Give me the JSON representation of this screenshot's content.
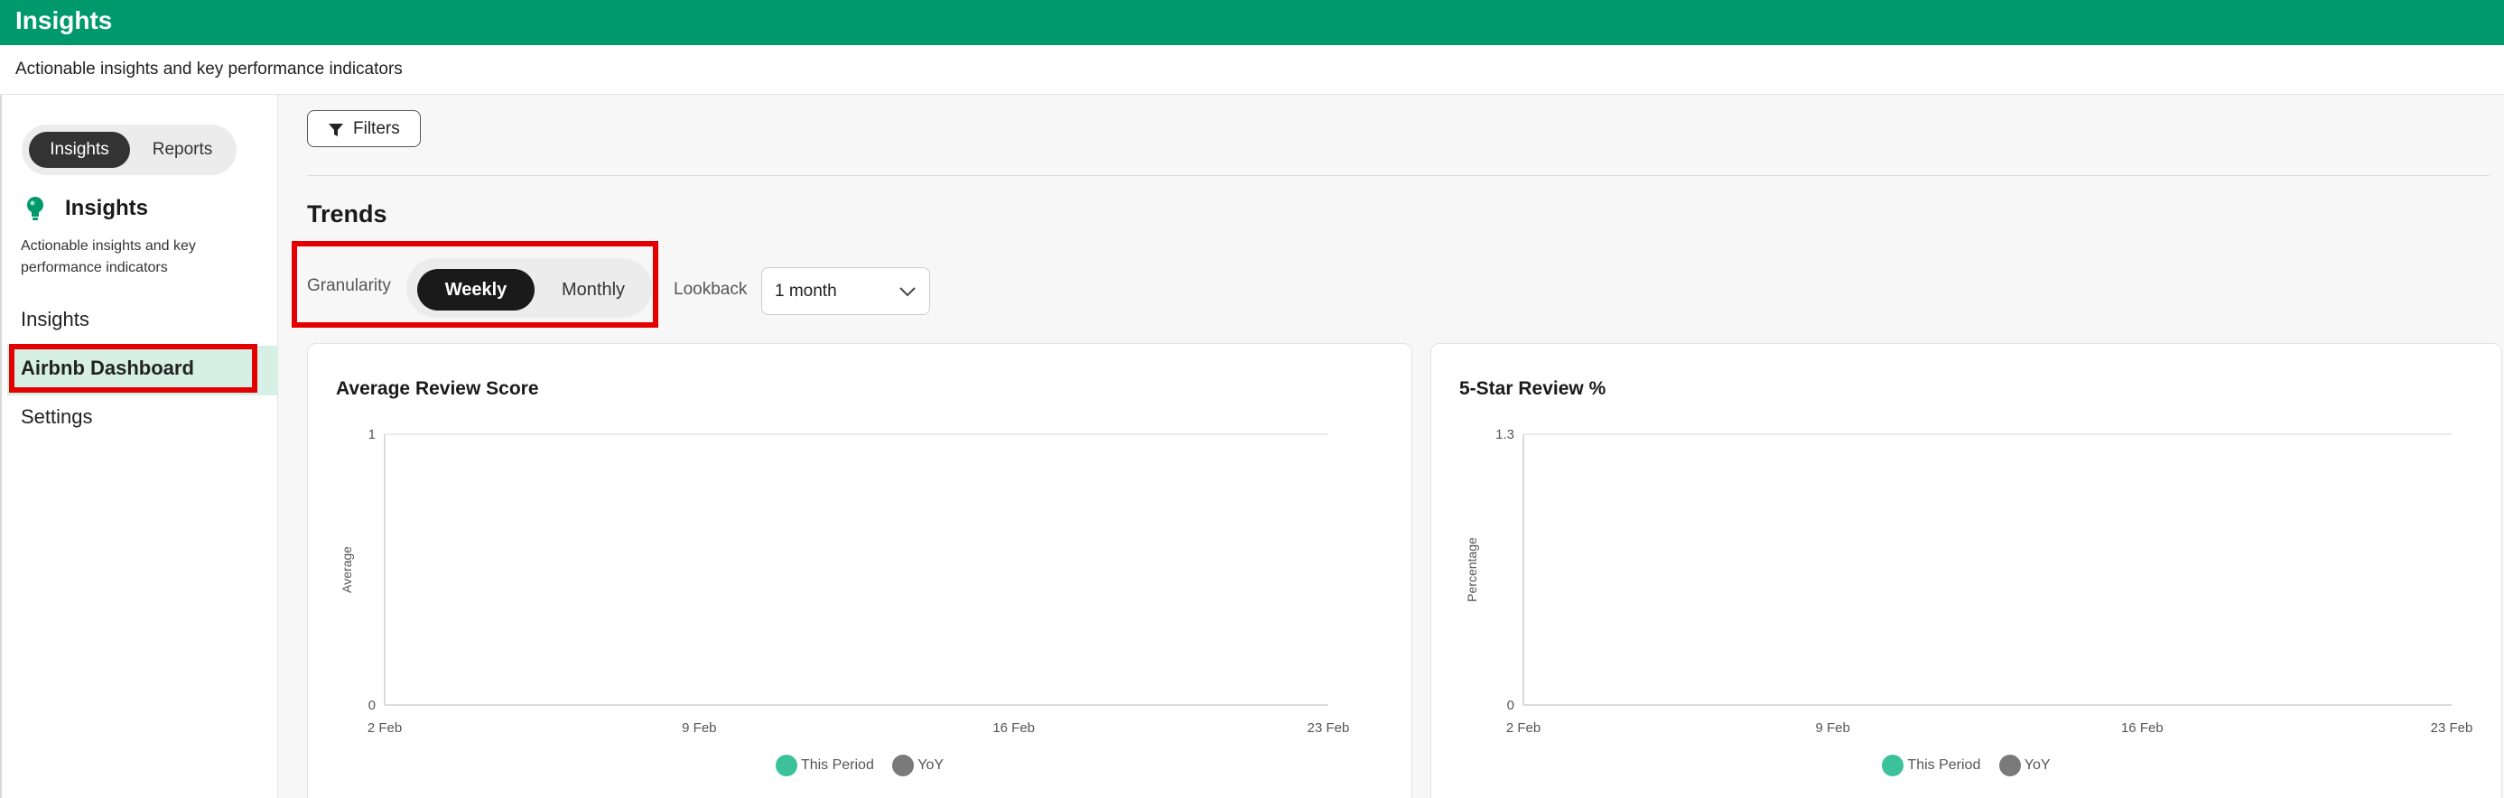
{
  "app": {
    "title": "Insights",
    "subtitle": "Actionable insights and key performance indicators"
  },
  "sidebar": {
    "segment": {
      "options": [
        "Insights",
        "Reports"
      ],
      "selected": "Insights"
    },
    "title": "Insights",
    "icon": "lightbulb-icon",
    "description": "Actionable insights and key performance indicators",
    "items": [
      {
        "label": "Insights"
      },
      {
        "label": "Airbnb Dashboard",
        "active": true
      },
      {
        "label": "Settings"
      }
    ]
  },
  "toolbar": {
    "filters_label": "Filters",
    "filters_icon": "filter-icon"
  },
  "trends": {
    "title": "Trends",
    "granularity_label": "Granularity",
    "granularity_options": [
      "Weekly",
      "Monthly"
    ],
    "granularity_selected": "Weekly",
    "lookback_label": "Lookback",
    "lookback_value": "1 month"
  },
  "colors": {
    "brand": "#00996b",
    "this_period": "#3cc29a",
    "yoy": "#7a7a7a",
    "highlight": "#e30000"
  },
  "chart_data": [
    {
      "type": "line",
      "title": "Average Review Score",
      "xlabel": "",
      "ylabel": "Average",
      "x_ticks": [
        "2 Feb",
        "9 Feb",
        "16 Feb",
        "23 Feb"
      ],
      "y_ticks": [
        "0",
        "1"
      ],
      "ylim": [
        0,
        1
      ],
      "series": [
        {
          "name": "This Period",
          "values": []
        },
        {
          "name": "YoY",
          "values": []
        }
      ]
    },
    {
      "type": "line",
      "title": "5-Star Review %",
      "xlabel": "",
      "ylabel": "Percentage",
      "x_ticks": [
        "2 Feb",
        "9 Feb",
        "16 Feb",
        "23 Feb"
      ],
      "y_ticks": [
        "0",
        "1.3"
      ],
      "ylim": [
        0,
        1.3
      ],
      "series": [
        {
          "name": "This Period",
          "values": []
        },
        {
          "name": "YoY",
          "values": []
        }
      ]
    }
  ]
}
